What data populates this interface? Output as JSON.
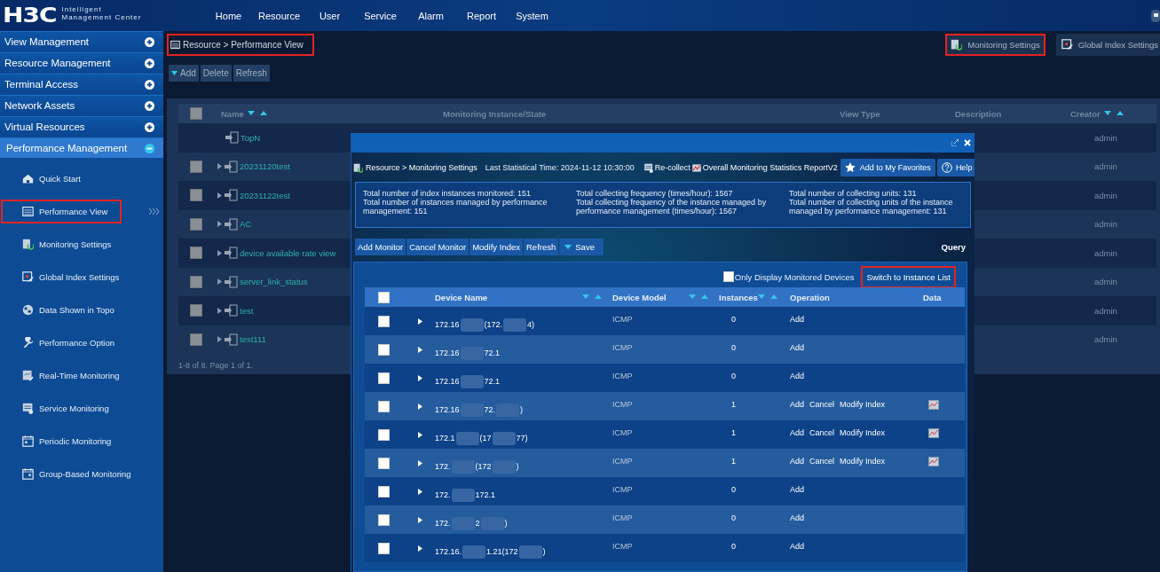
{
  "logo": {
    "mark": "H3C",
    "line1": "Intelligent",
    "line2": "Management Center"
  },
  "top_nav": [
    "Home",
    "Resource",
    "User",
    "Service",
    "Alarm",
    "Report",
    "System"
  ],
  "sidebar": {
    "groups": [
      {
        "label": "View Management",
        "expanded": false,
        "selected": false
      },
      {
        "label": "Resource Management",
        "expanded": false,
        "selected": false
      },
      {
        "label": "Terminal Access",
        "expanded": false,
        "selected": false
      },
      {
        "label": "Network Assets",
        "expanded": false,
        "selected": false
      },
      {
        "label": "Virtual Resources",
        "expanded": false,
        "selected": false
      },
      {
        "label": "Performance Management",
        "expanded": true,
        "selected": true
      }
    ],
    "items": [
      {
        "label": "Quick Start",
        "highlighted": false
      },
      {
        "label": "Performance View",
        "highlighted": true
      },
      {
        "label": "Monitoring Settings",
        "highlighted": false
      },
      {
        "label": "Global Index Settings",
        "highlighted": false
      },
      {
        "label": "Data Shown in Topo",
        "highlighted": false
      },
      {
        "label": "Performance Option",
        "highlighted": false
      },
      {
        "label": "Real-Time Monitoring",
        "highlighted": false
      },
      {
        "label": "Service Monitoring",
        "highlighted": false
      },
      {
        "label": "Periodic Monitoring",
        "highlighted": false
      },
      {
        "label": "Group-Based Monitoring",
        "highlighted": false
      }
    ]
  },
  "breadcrumb": {
    "text": "Resource > Performance View",
    "highlighted": true
  },
  "shortcuts": [
    {
      "label": "Monitoring Settings",
      "highlighted": true
    },
    {
      "label": "Global Index Settings",
      "highlighted": false
    }
  ],
  "toolbar": [
    {
      "label": "Add",
      "kind": "menu"
    },
    {
      "label": "Delete",
      "kind": "plain"
    },
    {
      "label": "Refresh",
      "kind": "plain"
    }
  ],
  "view_table": {
    "select_all_checked": false,
    "columns": [
      {
        "label": "Name",
        "sortable": true
      },
      {
        "label": "Monitoring Instance/State",
        "sortable": false
      },
      {
        "label": "View Type",
        "sortable": false
      },
      {
        "label": "Description",
        "sortable": false
      },
      {
        "label": "Creator",
        "sortable": true
      }
    ],
    "rows": [
      {
        "name": "TopN",
        "creator": "admin"
      },
      {
        "name": "20231120test",
        "creator": "admin",
        "checked": false,
        "expanded": false
      },
      {
        "name": "20231122test",
        "creator": "admin",
        "checked": false,
        "expanded": false
      },
      {
        "name": "AC",
        "creator": "admin",
        "checked": false,
        "expanded": false
      },
      {
        "name": "device available rate view",
        "creator": "admin",
        "checked": false,
        "expanded": false
      },
      {
        "name": "server_link_status",
        "creator": "admin",
        "checked": false,
        "expanded": false
      },
      {
        "name": "test",
        "creator": "admin",
        "checked": false,
        "expanded": false
      },
      {
        "name": "test111",
        "creator": "admin",
        "checked": false,
        "expanded": false
      }
    ],
    "footer": "1-8 of 8. Page 1 of 1."
  },
  "dialog": {
    "breadcrumb": "Resource > Monitoring Settings",
    "last_time": "Last Statistical Time: 2024-11-12 10:30:00",
    "links": [
      "Re-collect",
      "Overall Monitoring Statistics ReportV2"
    ],
    "buttons": [
      "Add to My Favorites",
      "Help"
    ],
    "stats": [
      [
        "Total number of index instances monitored: 151",
        "Total number of instances managed by performance management: 151"
      ],
      [
        "Total collecting frequency (times/hour): 1567",
        "Total collecting frequency of the instance managed by performance management (times/hour): 1567"
      ],
      [
        "Total number of collecting units: 131",
        "Total number of collecting units of the instance managed by performance management: 131"
      ]
    ],
    "toolbar": [
      {
        "label": "Add Monitor",
        "kind": "plain"
      },
      {
        "label": "Cancel Monitor",
        "kind": "plain"
      },
      {
        "label": "Modify Index",
        "kind": "plain"
      },
      {
        "label": "Refresh",
        "kind": "plain"
      },
      {
        "label": "Save",
        "kind": "menu"
      }
    ],
    "query": "Query",
    "filter": {
      "label": "Only Display Monitored Devices",
      "checked": false
    },
    "switch": {
      "label": "Switch to Instance List",
      "highlighted": true
    },
    "select_all_checked": false,
    "columns": [
      {
        "label": "Device Name",
        "sortable": true
      },
      {
        "label": "Device Model",
        "sortable": true
      },
      {
        "label": "Instances",
        "sortable": true
      },
      {
        "label": "Operation",
        "sortable": false
      },
      {
        "label": "Data",
        "sortable": false
      }
    ],
    "rows": [
      {
        "name_parts": [
          "172.16",
          "(172.",
          "4)"
        ],
        "model": "ICMP",
        "instances": "0",
        "operations": [
          "Add"
        ],
        "data_link": false,
        "checked": false,
        "expanded": false
      },
      {
        "name_parts": [
          "172.16",
          "72.1"
        ],
        "model": "ICMP",
        "instances": "0",
        "operations": [
          "Add"
        ],
        "data_link": false,
        "checked": false,
        "expanded": false
      },
      {
        "name_parts": [
          "172.16",
          "72.1"
        ],
        "model": "ICMP",
        "instances": "0",
        "operations": [
          "Add"
        ],
        "data_link": false,
        "checked": false,
        "expanded": false
      },
      {
        "name_parts": [
          "172.16",
          "72.",
          ")"
        ],
        "model": "ICMP",
        "instances": "1",
        "operations": [
          "Add",
          "Cancel",
          "Modify Index"
        ],
        "data_link": true,
        "checked": false,
        "expanded": false
      },
      {
        "name_parts": [
          "172.1",
          "(17",
          "77)"
        ],
        "model": "ICMP",
        "instances": "1",
        "operations": [
          "Add",
          "Cancel",
          "Modify Index"
        ],
        "data_link": true,
        "checked": false,
        "expanded": false
      },
      {
        "name_parts": [
          "172.",
          "(172",
          ")"
        ],
        "model": "ICMP",
        "instances": "1",
        "operations": [
          "Add",
          "Cancel",
          "Modify Index"
        ],
        "data_link": true,
        "checked": false,
        "expanded": false
      },
      {
        "name_parts": [
          "172.",
          "172.1"
        ],
        "model": "ICMP",
        "instances": "0",
        "operations": [
          "Add"
        ],
        "data_link": false,
        "checked": false,
        "expanded": false
      },
      {
        "name_parts": [
          "172.",
          "2",
          ")"
        ],
        "model": "ICMP",
        "instances": "0",
        "operations": [
          "Add"
        ],
        "data_link": false,
        "checked": false,
        "expanded": false
      },
      {
        "name_parts": [
          "172.16.",
          "1.21(172",
          ")"
        ],
        "model": "ICMP",
        "instances": "0",
        "operations": [
          "Add"
        ],
        "data_link": false,
        "checked": false,
        "expanded": false
      }
    ]
  }
}
